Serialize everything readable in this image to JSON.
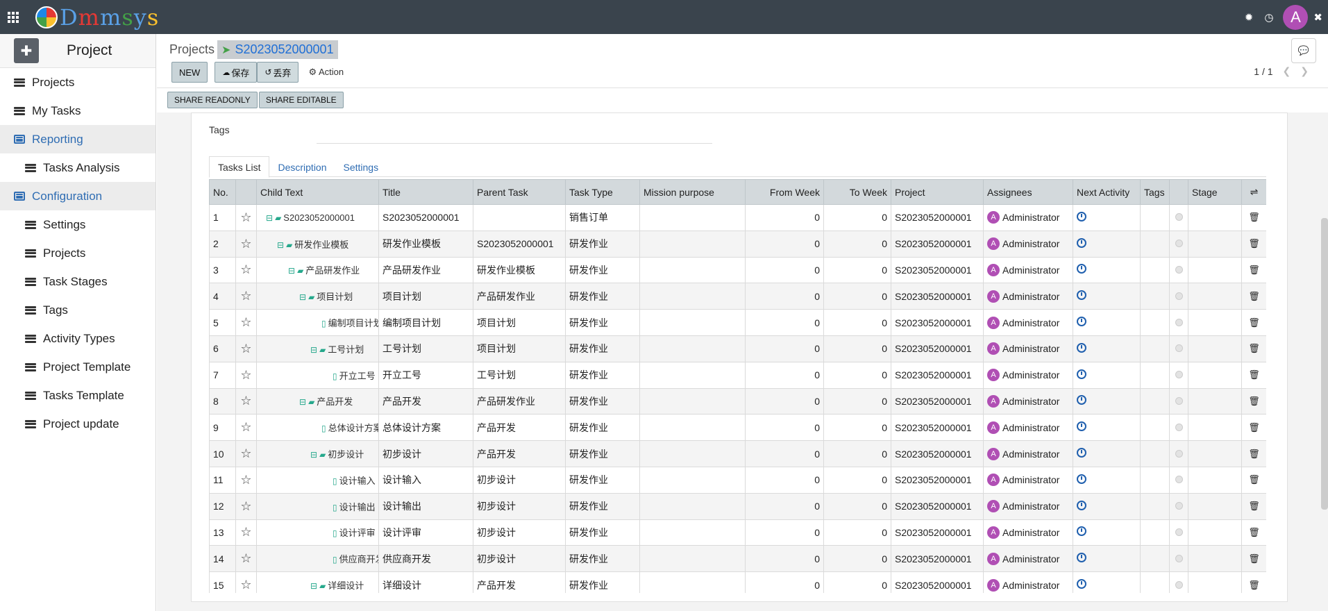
{
  "app": {
    "logo_text": "Dmmsys",
    "user_initial": "A"
  },
  "sidebar": {
    "title": "Project",
    "items": [
      {
        "label": "Projects",
        "type": "item"
      },
      {
        "label": "My Tasks",
        "type": "item"
      },
      {
        "label": "Reporting",
        "type": "section"
      },
      {
        "label": "Tasks Analysis",
        "type": "sub"
      },
      {
        "label": "Configuration",
        "type": "section"
      },
      {
        "label": "Settings",
        "type": "sub"
      },
      {
        "label": "Projects",
        "type": "sub"
      },
      {
        "label": "Task Stages",
        "type": "sub"
      },
      {
        "label": "Tags",
        "type": "sub"
      },
      {
        "label": "Activity Types",
        "type": "sub"
      },
      {
        "label": "Project Template",
        "type": "sub"
      },
      {
        "label": "Tasks Template",
        "type": "sub"
      },
      {
        "label": "Project update",
        "type": "sub"
      }
    ]
  },
  "breadcrumb": {
    "parent": "Projects",
    "current": "S2023052000001"
  },
  "toolbar": {
    "new_label": "NEW",
    "save_label": "保存",
    "discard_label": "丢弃",
    "action_label": "Action",
    "pager": "1 / 1",
    "share_readonly": "SHARE READONLY",
    "share_editable": "SHARE EDITABLE"
  },
  "form": {
    "tags_label": "Tags",
    "tabs": [
      "Tasks List",
      "Description",
      "Settings"
    ]
  },
  "table": {
    "headers": [
      "No.",
      "",
      "Child Text",
      "Title",
      "Parent Task",
      "Task Type",
      "Mission purpose",
      "From Week",
      "To Week",
      "Project",
      "Assignees",
      "Next Activity",
      "Tags",
      "",
      "Stage"
    ],
    "rows": [
      {
        "no": "1",
        "level": 0,
        "node": "folder",
        "child": "S2023052000001",
        "title": "S2023052000001",
        "parent": "",
        "type": "销售订单",
        "purpose": "",
        "from": "0",
        "to": "0",
        "project": "S2023052000001",
        "assignee": "Administrator"
      },
      {
        "no": "2",
        "level": 1,
        "node": "folder",
        "child": "研发作业模板",
        "title": "研发作业模板",
        "parent": "S2023052000001",
        "type": "研发作业",
        "purpose": "",
        "from": "0",
        "to": "0",
        "project": "S2023052000001",
        "assignee": "Administrator"
      },
      {
        "no": "3",
        "level": 2,
        "node": "folder",
        "child": "产品研发作业",
        "title": "产品研发作业",
        "parent": "研发作业模板",
        "type": "研发作业",
        "purpose": "",
        "from": "0",
        "to": "0",
        "project": "S2023052000001",
        "assignee": "Administrator"
      },
      {
        "no": "4",
        "level": 3,
        "node": "folder",
        "child": "项目计划",
        "title": "项目计划",
        "parent": "产品研发作业",
        "type": "研发作业",
        "purpose": "",
        "from": "0",
        "to": "0",
        "project": "S2023052000001",
        "assignee": "Administrator"
      },
      {
        "no": "5",
        "level": 4,
        "node": "file",
        "child": "编制项目计划",
        "title": "编制项目计划",
        "parent": "项目计划",
        "type": "研发作业",
        "purpose": "",
        "from": "0",
        "to": "0",
        "project": "S2023052000001",
        "assignee": "Administrator"
      },
      {
        "no": "6",
        "level": 4,
        "node": "folder",
        "child": "工号计划",
        "title": "工号计划",
        "parent": "项目计划",
        "type": "研发作业",
        "purpose": "",
        "from": "0",
        "to": "0",
        "project": "S2023052000001",
        "assignee": "Administrator"
      },
      {
        "no": "7",
        "level": 5,
        "node": "file",
        "child": "开立工号",
        "title": "开立工号",
        "parent": "工号计划",
        "type": "研发作业",
        "purpose": "",
        "from": "0",
        "to": "0",
        "project": "S2023052000001",
        "assignee": "Administrator"
      },
      {
        "no": "8",
        "level": 3,
        "node": "folder",
        "child": "产品开发",
        "title": "产品开发",
        "parent": "产品研发作业",
        "type": "研发作业",
        "purpose": "",
        "from": "0",
        "to": "0",
        "project": "S2023052000001",
        "assignee": "Administrator"
      },
      {
        "no": "9",
        "level": 4,
        "node": "file",
        "child": "总体设计方案",
        "title": "总体设计方案",
        "parent": "产品开发",
        "type": "研发作业",
        "purpose": "",
        "from": "0",
        "to": "0",
        "project": "S2023052000001",
        "assignee": "Administrator"
      },
      {
        "no": "10",
        "level": 4,
        "node": "folder",
        "child": "初步设计",
        "title": "初步设计",
        "parent": "产品开发",
        "type": "研发作业",
        "purpose": "",
        "from": "0",
        "to": "0",
        "project": "S2023052000001",
        "assignee": "Administrator"
      },
      {
        "no": "11",
        "level": 5,
        "node": "file",
        "child": "设计输入",
        "title": "设计输入",
        "parent": "初步设计",
        "type": "研发作业",
        "purpose": "",
        "from": "0",
        "to": "0",
        "project": "S2023052000001",
        "assignee": "Administrator"
      },
      {
        "no": "12",
        "level": 5,
        "node": "file",
        "child": "设计输出",
        "title": "设计输出",
        "parent": "初步设计",
        "type": "研发作业",
        "purpose": "",
        "from": "0",
        "to": "0",
        "project": "S2023052000001",
        "assignee": "Administrator"
      },
      {
        "no": "13",
        "level": 5,
        "node": "file",
        "child": "设计评审",
        "title": "设计评审",
        "parent": "初步设计",
        "type": "研发作业",
        "purpose": "",
        "from": "0",
        "to": "0",
        "project": "S2023052000001",
        "assignee": "Administrator"
      },
      {
        "no": "14",
        "level": 5,
        "node": "file",
        "child": "供应商开发",
        "title": "供应商开发",
        "parent": "初步设计",
        "type": "研发作业",
        "purpose": "",
        "from": "0",
        "to": "0",
        "project": "S2023052000001",
        "assignee": "Administrator"
      },
      {
        "no": "15",
        "level": 4,
        "node": "folder",
        "child": "详细设计",
        "title": "详细设计",
        "parent": "产品开发",
        "type": "研发作业",
        "purpose": "",
        "from": "0",
        "to": "0",
        "project": "S2023052000001",
        "assignee": "Administrator"
      }
    ]
  },
  "icons": {
    "apps": "apps-grid-icon",
    "bug": "bug-icon",
    "clock": "clock-icon",
    "close": "close-icon",
    "chat": "chat-icon",
    "cloud": "cloud-upload-icon",
    "undo": "undo-icon",
    "gear": "gear-icon",
    "star": "star-icon",
    "trash": "trash-icon",
    "adjust": "column-settings-icon"
  },
  "colors": {
    "topbar": "#3a444d",
    "accent": "#2f6db3",
    "avatar": "#b04fb4",
    "tree": "#26a88c"
  }
}
